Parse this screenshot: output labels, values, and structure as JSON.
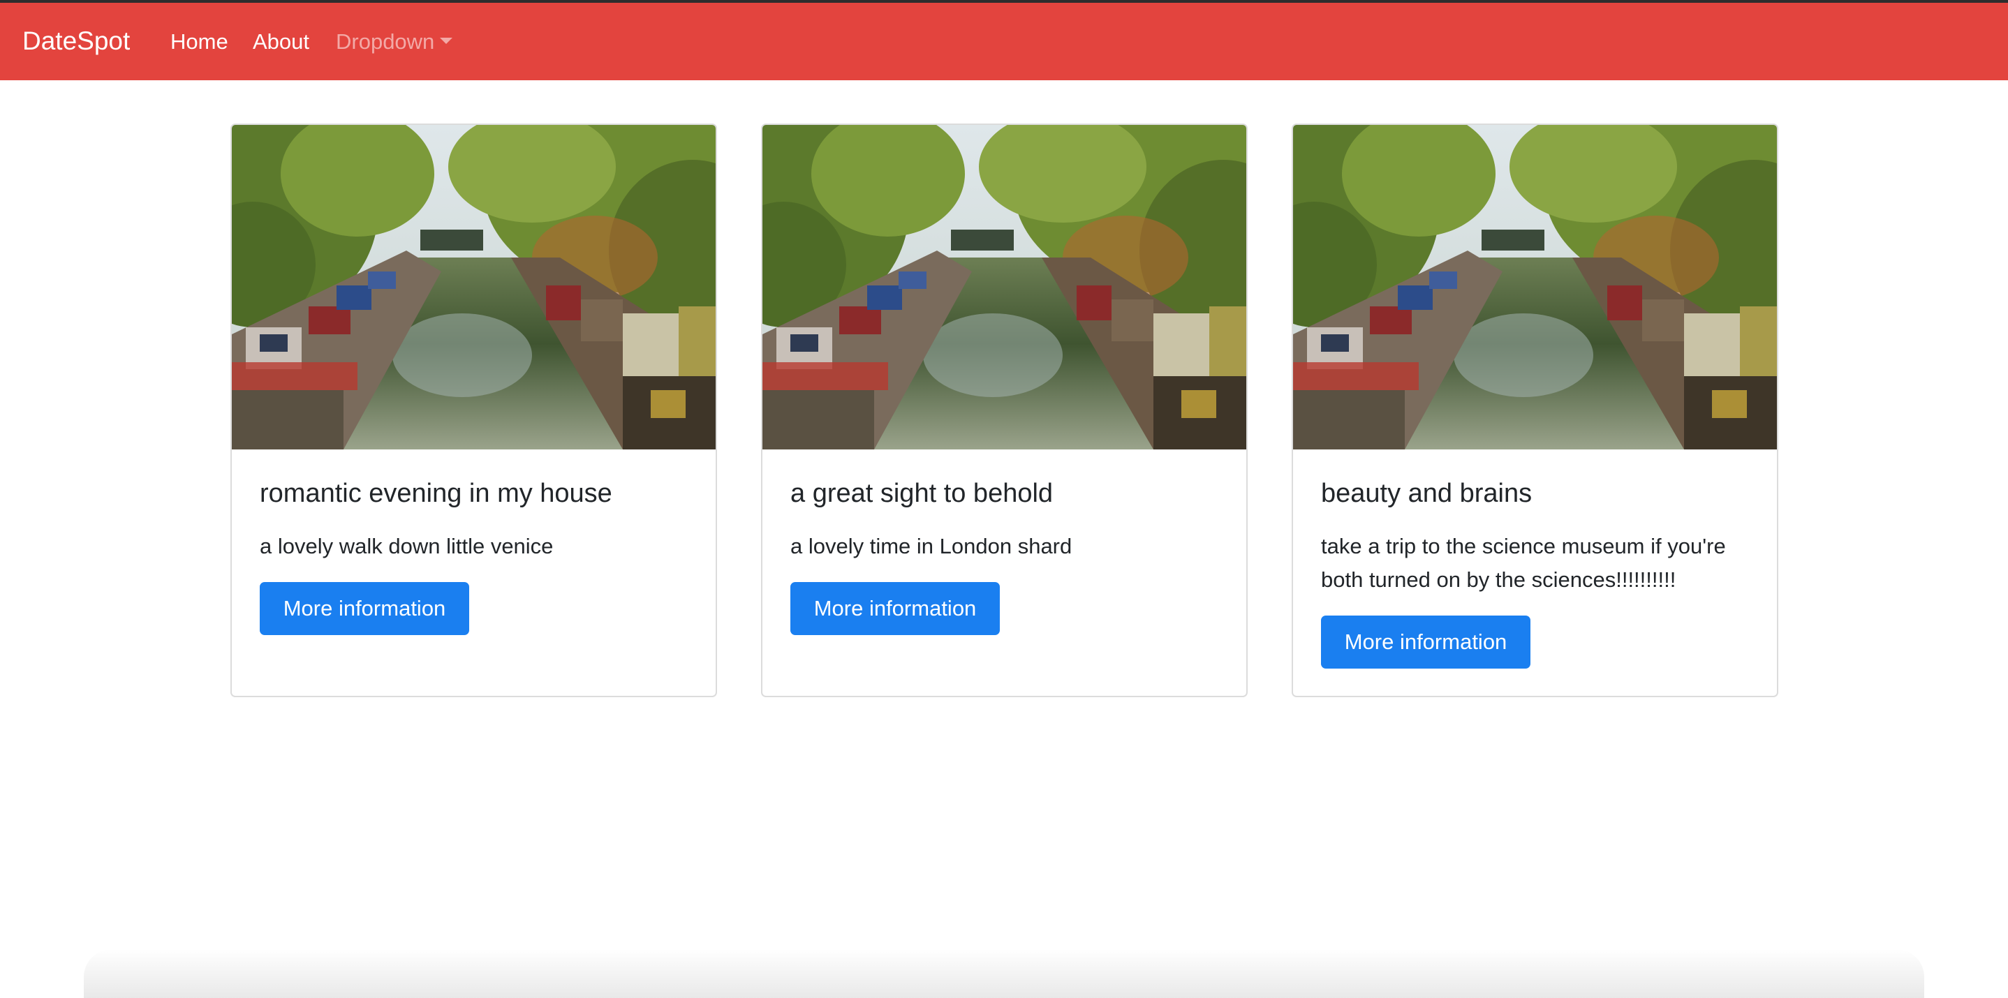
{
  "navbar": {
    "brand": "DateSpot",
    "links": [
      "Home",
      "About"
    ],
    "dropdown_label": "Dropdown",
    "background_color": "#e3443e"
  },
  "cards": [
    {
      "title": "romantic evening in my house",
      "text": "a lovely walk down little venice",
      "button_label": "More information"
    },
    {
      "title": "a great sight to behold",
      "text": "a lovely time in London shard",
      "button_label": "More information"
    },
    {
      "title": "beauty and brains",
      "text": "take a trip to the science museum if you're both turned on by the sciences!!!!!!!!!!",
      "button_label": "More information"
    }
  ],
  "colors": {
    "primary_button": "#1a7ff0",
    "text": "#212529"
  }
}
